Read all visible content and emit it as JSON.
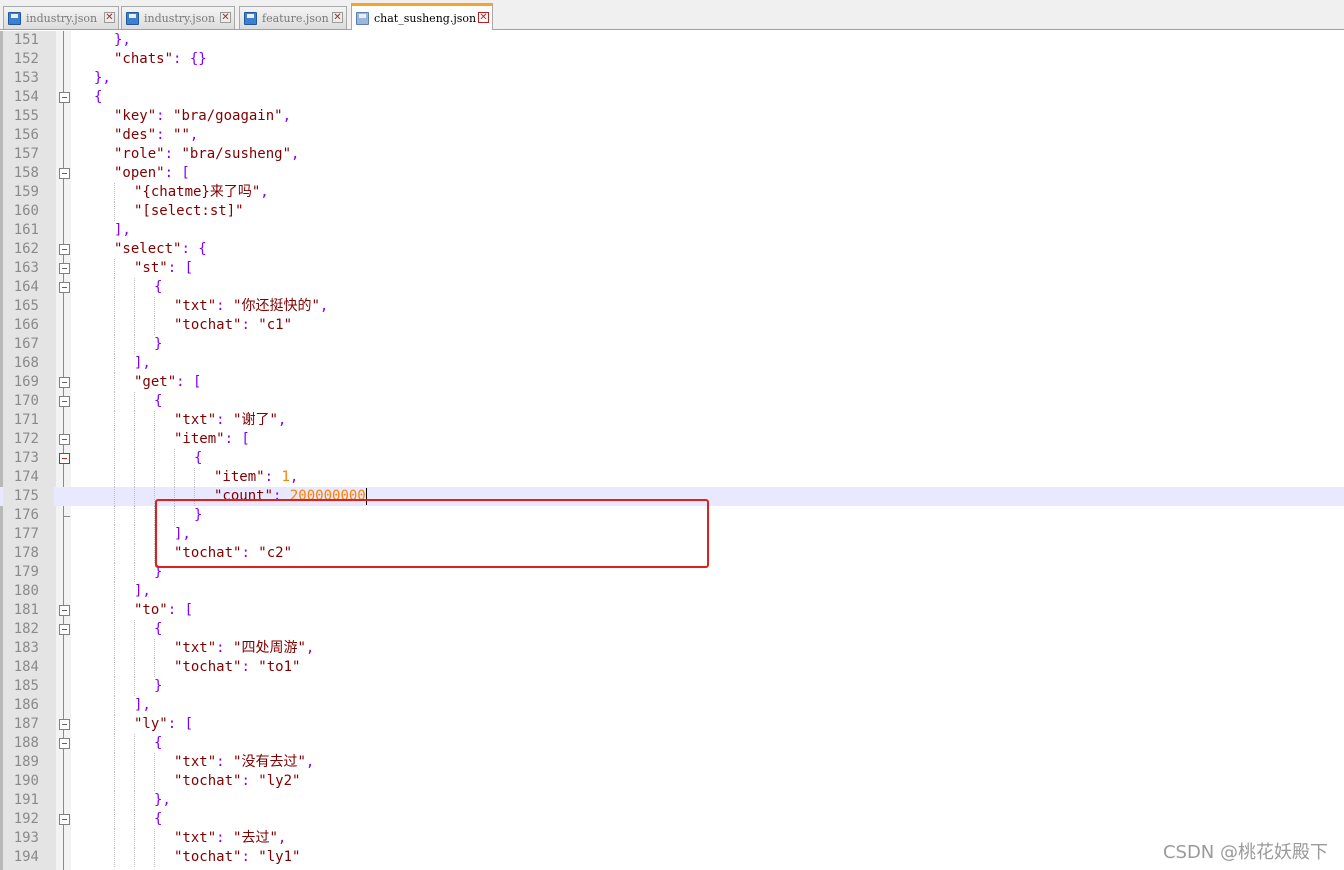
{
  "tabs": [
    {
      "label": "industry.json",
      "active": false
    },
    {
      "label": "industry.json",
      "active": false
    },
    {
      "label": "feature.json",
      "active": false
    },
    {
      "label": "chat_susheng.json",
      "active": true
    }
  ],
  "close_glyph": "✕",
  "colors": {
    "string": "#800000",
    "operator": "#8000ff",
    "number": "#ff8000",
    "highlight_box": "#e01f1f",
    "current_line": "#e8e8ff",
    "active_tab_accent": "#f6a623"
  },
  "icons": {
    "tab_file": "save-disk-icon",
    "tab_close": "close-icon",
    "fold": "fold-minus-icon"
  },
  "editor": {
    "current_line": 175,
    "lines": [
      {
        "n": "151",
        "i": 2,
        "t": [
          [
            "op",
            "},"
          ]
        ]
      },
      {
        "n": "152",
        "i": 2,
        "t": [
          [
            "str",
            "\"chats\""
          ],
          [
            "op",
            ": {}"
          ]
        ]
      },
      {
        "n": "153",
        "i": 1,
        "t": [
          [
            "op",
            "},"
          ]
        ]
      },
      {
        "n": "154",
        "i": 1,
        "t": [
          [
            "op",
            "{"
          ]
        ],
        "fold": "minus"
      },
      {
        "n": "155",
        "i": 2,
        "t": [
          [
            "str",
            "\"key\""
          ],
          [
            "op",
            ": "
          ],
          [
            "str",
            "\"bra/goagain\""
          ],
          [
            "op",
            ","
          ]
        ]
      },
      {
        "n": "156",
        "i": 2,
        "t": [
          [
            "str",
            "\"des\""
          ],
          [
            "op",
            ": "
          ],
          [
            "str",
            "\"\""
          ],
          [
            "op",
            ","
          ]
        ]
      },
      {
        "n": "157",
        "i": 2,
        "t": [
          [
            "str",
            "\"role\""
          ],
          [
            "op",
            ": "
          ],
          [
            "str",
            "\"bra/susheng\""
          ],
          [
            "op",
            ","
          ]
        ]
      },
      {
        "n": "158",
        "i": 2,
        "t": [
          [
            "str",
            "\"open\""
          ],
          [
            "op",
            ": ["
          ]
        ],
        "fold": "minus"
      },
      {
        "n": "159",
        "i": 3,
        "t": [
          [
            "str",
            "\"{chatme}来了吗\""
          ],
          [
            "op",
            ","
          ]
        ]
      },
      {
        "n": "160",
        "i": 3,
        "t": [
          [
            "str",
            "\"[select:st]\""
          ]
        ]
      },
      {
        "n": "161",
        "i": 2,
        "t": [
          [
            "op",
            "],"
          ]
        ]
      },
      {
        "n": "162",
        "i": 2,
        "t": [
          [
            "str",
            "\"select\""
          ],
          [
            "op",
            ": {"
          ]
        ],
        "fold": "minus"
      },
      {
        "n": "163",
        "i": 3,
        "t": [
          [
            "str",
            "\"st\""
          ],
          [
            "op",
            ": ["
          ]
        ],
        "fold": "minus"
      },
      {
        "n": "164",
        "i": 4,
        "t": [
          [
            "op",
            "{"
          ]
        ],
        "fold": "minus"
      },
      {
        "n": "165",
        "i": 5,
        "t": [
          [
            "str",
            "\"txt\""
          ],
          [
            "op",
            ": "
          ],
          [
            "str",
            "\"你还挺快的\""
          ],
          [
            "op",
            ","
          ]
        ]
      },
      {
        "n": "166",
        "i": 5,
        "t": [
          [
            "str",
            "\"tochat\""
          ],
          [
            "op",
            ": "
          ],
          [
            "str",
            "\"c1\""
          ]
        ]
      },
      {
        "n": "167",
        "i": 4,
        "t": [
          [
            "op",
            "}"
          ]
        ]
      },
      {
        "n": "168",
        "i": 3,
        "t": [
          [
            "op",
            "],"
          ]
        ]
      },
      {
        "n": "169",
        "i": 3,
        "t": [
          [
            "str",
            "\"get\""
          ],
          [
            "op",
            ": ["
          ]
        ],
        "fold": "minus"
      },
      {
        "n": "170",
        "i": 4,
        "t": [
          [
            "op",
            "{"
          ]
        ],
        "fold": "minus"
      },
      {
        "n": "171",
        "i": 5,
        "t": [
          [
            "str",
            "\"txt\""
          ],
          [
            "op",
            ": "
          ],
          [
            "str",
            "\"谢了\""
          ],
          [
            "op",
            ","
          ]
        ]
      },
      {
        "n": "172",
        "i": 5,
        "t": [
          [
            "str",
            "\"item\""
          ],
          [
            "op",
            ": ["
          ]
        ],
        "fold": "minus"
      },
      {
        "n": "173",
        "i": 6,
        "t": [
          [
            "op",
            "{"
          ]
        ],
        "fold": "red"
      },
      {
        "n": "174",
        "i": 7,
        "t": [
          [
            "str",
            "\"item\""
          ],
          [
            "op",
            ": "
          ],
          [
            "num",
            "1"
          ],
          [
            "op",
            ","
          ]
        ]
      },
      {
        "n": "175",
        "i": 7,
        "t": [
          [
            "str",
            "\"count\""
          ],
          [
            "op",
            ": "
          ],
          [
            "num",
            "200000000"
          ]
        ]
      },
      {
        "n": "176",
        "i": 6,
        "t": [
          [
            "op",
            "}"
          ]
        ],
        "fold": "end"
      },
      {
        "n": "177",
        "i": 5,
        "t": [
          [
            "op",
            "],"
          ]
        ]
      },
      {
        "n": "178",
        "i": 5,
        "t": [
          [
            "str",
            "\"tochat\""
          ],
          [
            "op",
            ": "
          ],
          [
            "str",
            "\"c2\""
          ]
        ]
      },
      {
        "n": "179",
        "i": 4,
        "t": [
          [
            "op",
            "}"
          ]
        ]
      },
      {
        "n": "180",
        "i": 3,
        "t": [
          [
            "op",
            "],"
          ]
        ]
      },
      {
        "n": "181",
        "i": 3,
        "t": [
          [
            "str",
            "\"to\""
          ],
          [
            "op",
            ": ["
          ]
        ],
        "fold": "minus"
      },
      {
        "n": "182",
        "i": 4,
        "t": [
          [
            "op",
            "{"
          ]
        ],
        "fold": "minus"
      },
      {
        "n": "183",
        "i": 5,
        "t": [
          [
            "str",
            "\"txt\""
          ],
          [
            "op",
            ": "
          ],
          [
            "str",
            "\"四处周游\""
          ],
          [
            "op",
            ","
          ]
        ]
      },
      {
        "n": "184",
        "i": 5,
        "t": [
          [
            "str",
            "\"tochat\""
          ],
          [
            "op",
            ": "
          ],
          [
            "str",
            "\"to1\""
          ]
        ]
      },
      {
        "n": "185",
        "i": 4,
        "t": [
          [
            "op",
            "}"
          ]
        ]
      },
      {
        "n": "186",
        "i": 3,
        "t": [
          [
            "op",
            "],"
          ]
        ]
      },
      {
        "n": "187",
        "i": 3,
        "t": [
          [
            "str",
            "\"ly\""
          ],
          [
            "op",
            ": ["
          ]
        ],
        "fold": "minus"
      },
      {
        "n": "188",
        "i": 4,
        "t": [
          [
            "op",
            "{"
          ]
        ],
        "fold": "minus"
      },
      {
        "n": "189",
        "i": 5,
        "t": [
          [
            "str",
            "\"txt\""
          ],
          [
            "op",
            ": "
          ],
          [
            "str",
            "\"没有去过\""
          ],
          [
            "op",
            ","
          ]
        ]
      },
      {
        "n": "190",
        "i": 5,
        "t": [
          [
            "str",
            "\"tochat\""
          ],
          [
            "op",
            ": "
          ],
          [
            "str",
            "\"ly2\""
          ]
        ]
      },
      {
        "n": "191",
        "i": 4,
        "t": [
          [
            "op",
            "},"
          ]
        ]
      },
      {
        "n": "192",
        "i": 4,
        "t": [
          [
            "op",
            "{"
          ]
        ],
        "fold": "minus"
      },
      {
        "n": "193",
        "i": 5,
        "t": [
          [
            "str",
            "\"txt\""
          ],
          [
            "op",
            ": "
          ],
          [
            "str",
            "\"去过\""
          ],
          [
            "op",
            ","
          ]
        ]
      },
      {
        "n": "194",
        "i": 5,
        "t": [
          [
            "str",
            "\"tochat\""
          ],
          [
            "op",
            ": "
          ],
          [
            "str",
            "\"ly1\""
          ]
        ]
      }
    ]
  },
  "watermark": "CSDN @桃花妖殿下"
}
